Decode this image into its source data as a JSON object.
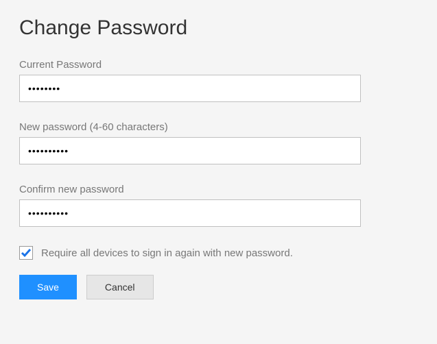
{
  "title": "Change Password",
  "fields": {
    "current": {
      "label": "Current Password",
      "value": "••••••••"
    },
    "new": {
      "label": "New password (4-60 characters)",
      "value": "••••••••••"
    },
    "confirm": {
      "label": "Confirm new password",
      "value": "••••••••••"
    }
  },
  "checkbox": {
    "label": "Require all devices to sign in again with new password.",
    "checked": true
  },
  "buttons": {
    "save": "Save",
    "cancel": "Cancel"
  }
}
